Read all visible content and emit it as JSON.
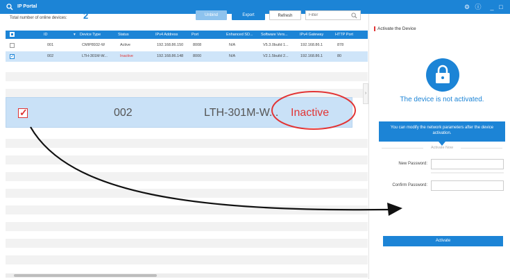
{
  "app": {
    "title": "IP Portal"
  },
  "colors": {
    "brand": "#1c84d6",
    "inactive": "#e23434",
    "selected_row": "#cfe5f9"
  },
  "toolbar": {
    "count_label": "Total number of online devices:",
    "count_value": "2",
    "unbind_label": "Unbind",
    "export_label": "Export",
    "refresh_label": "Refresh",
    "filter_placeholder": "Filter"
  },
  "table": {
    "headers": [
      "ID",
      "Device Type",
      "Status",
      "IPv4 Address",
      "Port",
      "Enhanced SD...",
      "Software Vers...",
      "IPv4 Gateway",
      "HTTP Port"
    ],
    "rows": [
      {
        "checked": false,
        "id": "001",
        "type": "CMIP8932-W",
        "status": "Active",
        "ip": "192.168.86.150",
        "port": "8008",
        "sdk": "N/A",
        "software": "V5.3.0build 1...",
        "gateway": "192.168.86.1",
        "http": "878"
      },
      {
        "checked": true,
        "id": "002",
        "type": "LTH-301M-W...",
        "status": "Inactive",
        "ip": "192.168.86.148",
        "port": "8000",
        "sdk": "N/A",
        "software": "V2.1.5build 2...",
        "gateway": "192.168.86.1",
        "http": "80"
      }
    ]
  },
  "zoom": {
    "id": "002",
    "type": "LTH-301M-W...",
    "status": "Inactive"
  },
  "panel": {
    "title": "Activate the Device",
    "not_activated": "The device is not activated.",
    "info": "You can modify the network parameters after the device activation.",
    "activate_now": "Activate Now",
    "new_password_label": "New Password:",
    "confirm_password_label": "Confirm Password:",
    "activate_label": "Activate"
  }
}
